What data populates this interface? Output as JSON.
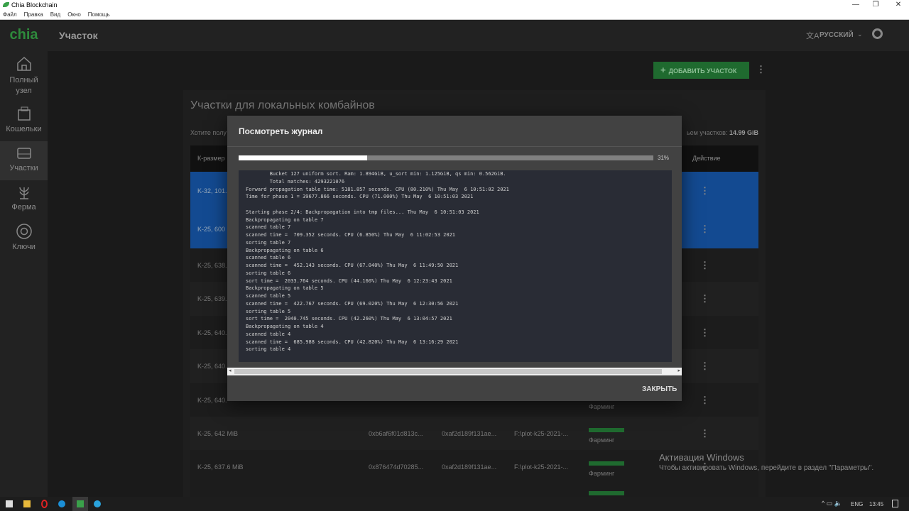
{
  "window": {
    "title": "Chia Blockchain",
    "menu": [
      "Файл",
      "Правка",
      "Вид",
      "Окно",
      "Помощь"
    ]
  },
  "header": {
    "logo": "chia",
    "title": "Участок",
    "language": "РУССКИЙ"
  },
  "sidebar": [
    {
      "label": "Полный узел",
      "icon": "home-icon"
    },
    {
      "label": "Кошельки",
      "icon": "wallet-icon"
    },
    {
      "label": "Участки",
      "icon": "hard-drive-icon",
      "active": true
    },
    {
      "label": "Ферма",
      "icon": "plant-icon"
    },
    {
      "label": "Ключи",
      "icon": "lifebuoy-icon"
    }
  ],
  "toolbar": {
    "add_plot": "ДОБАВИТЬ УЧАСТОК"
  },
  "card": {
    "title": "Участки для локальных комбайнов",
    "subtitle_left": "Хотите полу",
    "subtitle_right": "ьем участков: ",
    "total_size": "14.99 GiB",
    "col_size": "К-размер",
    "col_action": "Действие"
  },
  "rows": [
    {
      "size": "K-32, 101."
    },
    {
      "size": "K-25, 600"
    },
    {
      "size": "K-25, 638."
    },
    {
      "size": "K-25, 639."
    },
    {
      "size": "K-25, 640."
    },
    {
      "size": "K-25, 640."
    },
    {
      "size": "K-25, 640.",
      "status": "Фарминг"
    },
    {
      "size": "K-25, 642 MiB",
      "plot_key": "0xb6af6f01d813c...",
      "pool_key": "0xaf2d189f131ae...",
      "file": "F:\\plot-k25-2021-...",
      "status": "Фарминг"
    },
    {
      "size": "K-25, 637.6 MiB",
      "plot_key": "0x876474d70285...",
      "pool_key": "0xaf2d189f131ae...",
      "file": "F:\\plot-k25-2021-...",
      "status": "Фарминг"
    }
  ],
  "modal": {
    "title": "Посмотреть журнал",
    "progress_percent": 31,
    "progress_label": "31%",
    "close": "ЗАКРЫТЬ",
    "log": [
      "        Bucket 127 uniform sort. Ram: 1.894GiB, u_sort min: 1.125GiB, qs min: 0.562GiB.",
      "        Total matches: 4293221076",
      "Forward propagation table time: 5181.857 seconds. CPU (80.210%) Thu May  6 10:51:02 2021",
      "Time for phase 1 = 39677.866 seconds. CPU (71.000%) Thu May  6 10:51:03 2021",
      "",
      "Starting phase 2/4: Backpropagation into tmp files... Thu May  6 10:51:03 2021",
      "Backpropagating on table 7",
      "scanned table 7",
      "scanned time =  709.352 seconds. CPU (6.850%) Thu May  6 11:02:53 2021",
      "sorting table 7",
      "Backpropagating on table 6",
      "scanned table 6",
      "scanned time =  452.143 seconds. CPU (67.040%) Thu May  6 11:49:50 2021",
      "sorting table 6",
      "sort time =  2033.764 seconds. CPU (44.160%) Thu May  6 12:23:43 2021",
      "Backpropagating on table 5",
      "scanned table 5",
      "scanned time =  422.767 seconds. CPU (69.020%) Thu May  6 12:30:56 2021",
      "sorting table 5",
      "sort time =  2040.745 seconds. CPU (42.260%) Thu May  6 13:04:57 2021",
      "Backpropagating on table 4",
      "scanned table 4",
      "scanned time =  685.988 seconds. CPU (42.820%) Thu May  6 13:16:29 2021",
      "sorting table 4"
    ]
  },
  "watermark": {
    "title": "Активация Windows",
    "text": "Чтобы активировать Windows, перейдите в раздел \"Параметры\"."
  },
  "taskbar": {
    "lang": "ENG",
    "time": "13:45"
  },
  "colors": {
    "accent": "#2e8a3c",
    "selected_row": "#134a91"
  }
}
